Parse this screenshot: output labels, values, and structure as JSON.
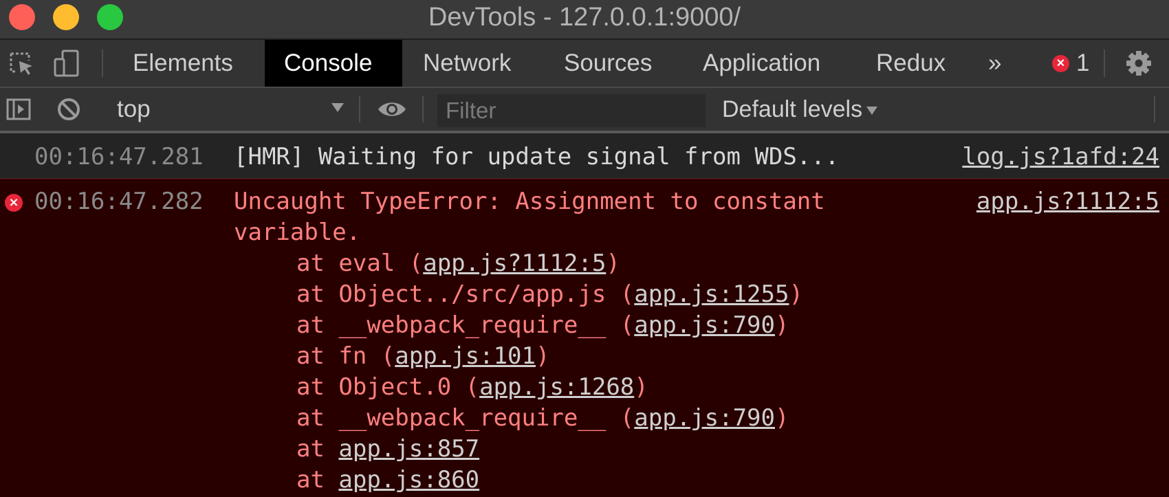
{
  "window": {
    "title": "DevTools - 127.0.0.1:9000/"
  },
  "tabs": [
    {
      "label": "Elements"
    },
    {
      "label": "Console"
    },
    {
      "label": "Network"
    },
    {
      "label": "Sources"
    },
    {
      "label": "Application"
    },
    {
      "label": "Redux"
    }
  ],
  "more_tabs_label": "»",
  "error_count": "1",
  "toolbar": {
    "context": "top",
    "filter_placeholder": "Filter",
    "levels_label": "Default levels"
  },
  "logs": [
    {
      "time": "00:16:47.281",
      "message": "[HMR] Waiting for update signal from WDS...",
      "source": "log.js?1afd:24"
    }
  ],
  "error": {
    "time": "00:16:47.282",
    "message_line1": "Uncaught TypeError: Assignment to constant",
    "message_line2": "variable.",
    "source": "app.js?1112:5",
    "stack": [
      {
        "prefix": "at eval (",
        "link": "app.js?1112:5",
        "suffix": ")"
      },
      {
        "prefix": "at Object../src/app.js (",
        "link": "app.js:1255",
        "suffix": ")"
      },
      {
        "prefix": "at __webpack_require__ (",
        "link": "app.js:790",
        "suffix": ")"
      },
      {
        "prefix": "at fn (",
        "link": "app.js:101",
        "suffix": ")"
      },
      {
        "prefix": "at Object.0 (",
        "link": "app.js:1268",
        "suffix": ")"
      },
      {
        "prefix": "at __webpack_require__ (",
        "link": "app.js:790",
        "suffix": ")"
      },
      {
        "prefix": "at ",
        "link": "app.js:857",
        "suffix": ""
      },
      {
        "prefix": "at ",
        "link": "app.js:860",
        "suffix": ""
      }
    ]
  },
  "colors": {
    "error_bg": "#290000",
    "error_text": "#ff8080",
    "active_tab_bg": "#000000",
    "error_badge": "#e8263a"
  }
}
